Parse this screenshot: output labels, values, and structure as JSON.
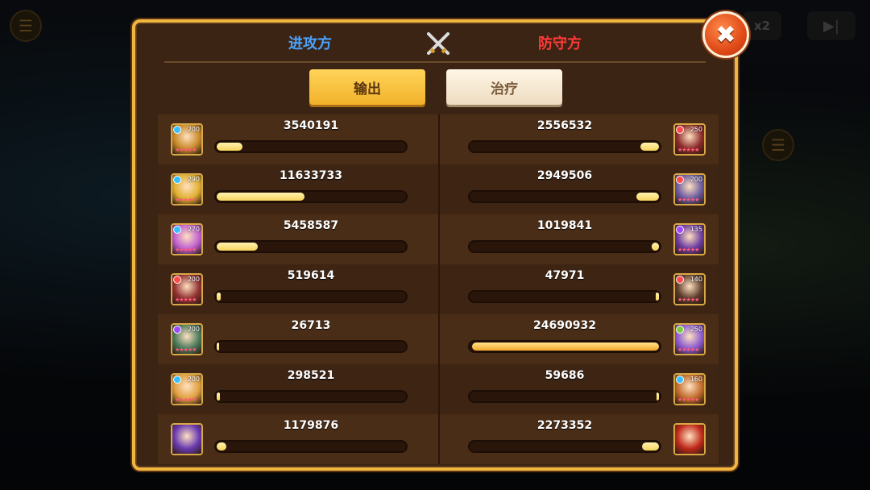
{
  "header": {
    "attacker_label": "进攻方",
    "defender_label": "防守方",
    "close_symbol": "✖"
  },
  "tabs": [
    {
      "label": "输出",
      "active": true
    },
    {
      "label": "治疗",
      "active": false
    }
  ],
  "background": {
    "speed_label": "x2"
  },
  "rows": [
    {
      "left": {
        "value": "3540191",
        "level": "200",
        "fill": 0.14,
        "color": "#c98a2a",
        "elem": "#3ac0ff"
      },
      "right": {
        "value": "2556532",
        "level": "250",
        "fill": 0.1,
        "color": "#8a2a2a",
        "elem": "#ff4a4a"
      }
    },
    {
      "left": {
        "value": "11633733",
        "level": "290",
        "fill": 0.47,
        "color": "#e0b030",
        "elem": "#3ac0ff"
      },
      "right": {
        "value": "2949506",
        "level": "200",
        "fill": 0.12,
        "color": "#6a5aa0",
        "elem": "#ff4a4a"
      }
    },
    {
      "left": {
        "value": "5458587",
        "level": "270",
        "fill": 0.22,
        "color": "#c060d0",
        "elem": "#3ac0ff"
      },
      "right": {
        "value": "1019841",
        "level": "135",
        "fill": 0.04,
        "color": "#6a3aa0",
        "elem": "#a04aff"
      }
    },
    {
      "left": {
        "value": "519614",
        "level": "200",
        "fill": 0.02,
        "color": "#903030",
        "elem": "#ff4a4a"
      },
      "right": {
        "value": "47971",
        "level": "140",
        "fill": 0.01,
        "color": "#5a3a2a",
        "elem": "#ff4a4a"
      }
    },
    {
      "left": {
        "value": "26713",
        "level": "200",
        "fill": 0.0,
        "color": "#4a7a5a",
        "elem": "#a04aff"
      },
      "right": {
        "value": "24690932",
        "level": "250",
        "fill": 1.0,
        "color": "#8a5ad0",
        "elem": "#7acc3a"
      }
    },
    {
      "left": {
        "value": "298521",
        "level": "200",
        "fill": 0.01,
        "color": "#e0a040",
        "elem": "#3ac0ff"
      },
      "right": {
        "value": "59686",
        "level": "160",
        "fill": 0.0,
        "color": "#c06a2a",
        "elem": "#3ac0ff"
      }
    },
    {
      "left": {
        "value": "1179876",
        "level": "",
        "fill": 0.05,
        "color": "#6a3ab0",
        "elem": ""
      },
      "right": {
        "value": "2273352",
        "level": "",
        "fill": 0.09,
        "color": "#c02a1a",
        "elem": ""
      }
    }
  ],
  "icons": {
    "crossed_swords": "crossed-swords-icon",
    "close": "close-icon"
  }
}
